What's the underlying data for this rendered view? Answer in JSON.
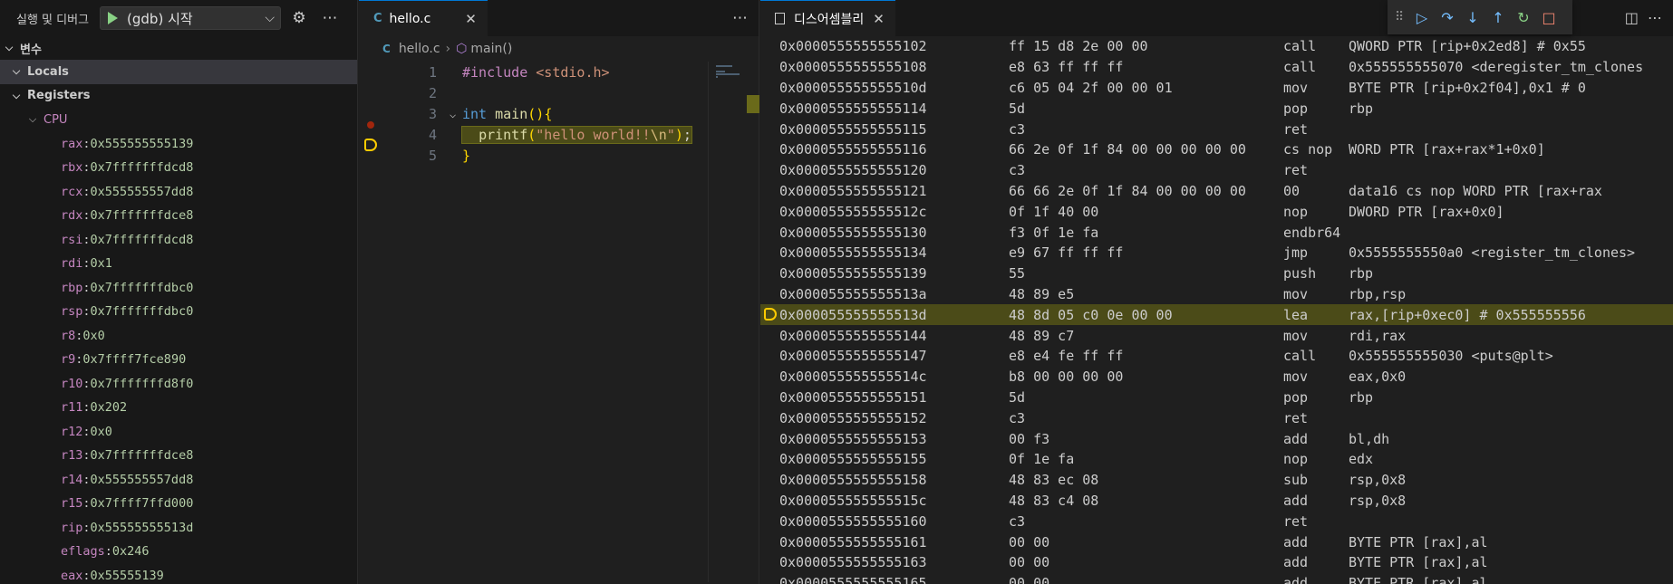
{
  "run": {
    "title": "실행 및 디버그",
    "config": "(gdb) 시작"
  },
  "variables": {
    "header": "변수",
    "locals": "Locals",
    "registers": "Registers",
    "cpu": "CPU",
    "regs": [
      {
        "name": "rax",
        "value": "0x555555555139"
      },
      {
        "name": "rbx",
        "value": "0x7fffffffdcd8"
      },
      {
        "name": "rcx",
        "value": "0x555555557dd8"
      },
      {
        "name": "rdx",
        "value": "0x7fffffffdce8"
      },
      {
        "name": "rsi",
        "value": "0x7fffffffdcd8"
      },
      {
        "name": "rdi",
        "value": "0x1"
      },
      {
        "name": "rbp",
        "value": "0x7fffffffdbc0"
      },
      {
        "name": "rsp",
        "value": "0x7fffffffdbc0"
      },
      {
        "name": "r8",
        "value": "0x0"
      },
      {
        "name": "r9",
        "value": "0x7ffff7fce890"
      },
      {
        "name": "r10",
        "value": "0x7fffffffd8f0"
      },
      {
        "name": "r11",
        "value": "0x202"
      },
      {
        "name": "r12",
        "value": "0x0"
      },
      {
        "name": "r13",
        "value": "0x7fffffffdce8"
      },
      {
        "name": "r14",
        "value": "0x555555557dd8"
      },
      {
        "name": "r15",
        "value": "0x7ffff7ffd000"
      },
      {
        "name": "rip",
        "value": "0x55555555513d"
      },
      {
        "name": "eflags",
        "value": "0x246"
      },
      {
        "name": "eax",
        "value": "0x55555139"
      }
    ]
  },
  "editor": {
    "tab_icon": "C",
    "tab_label": "hello.c",
    "breadcrumb_file": "hello.c",
    "breadcrumb_symbol": "main()",
    "lines": [
      {
        "num": "1",
        "text": "#include <stdio.h>"
      },
      {
        "num": "2",
        "text": ""
      },
      {
        "num": "3",
        "text": "int main(){"
      },
      {
        "num": "4",
        "text": "  printf(\"hello world!!\\n\");"
      },
      {
        "num": "5",
        "text": "}"
      }
    ],
    "current_line": 4,
    "breakpoint_line": 3
  },
  "disassembly": {
    "tab_label": "디스어셈블리",
    "current_index": 13,
    "rows": [
      {
        "addr": "0x0000555555555102",
        "bytes": "ff 15 d8 2e 00 00",
        "mnem": "call",
        "ops": "QWORD PTR [rip+0x2ed8]        # 0x55"
      },
      {
        "addr": "0x0000555555555108",
        "bytes": "e8 63 ff ff ff",
        "mnem": "call",
        "ops": "0x555555555070 <deregister_tm_clones"
      },
      {
        "addr": "0x000055555555510d",
        "bytes": "c6 05 04 2f 00 00 01",
        "mnem": "mov",
        "ops": "BYTE PTR [rip+0x2f04],0x1        # 0"
      },
      {
        "addr": "0x0000555555555114",
        "bytes": "5d",
        "mnem": "pop",
        "ops": "rbp"
      },
      {
        "addr": "0x0000555555555115",
        "bytes": "c3",
        "mnem": "ret",
        "ops": ""
      },
      {
        "addr": "0x0000555555555116",
        "bytes": "66 2e 0f 1f 84 00 00 00 00 00",
        "mnem": "cs nop",
        "ops": "WORD PTR [rax+rax*1+0x0]"
      },
      {
        "addr": "0x0000555555555120",
        "bytes": "c3",
        "mnem": "ret",
        "ops": ""
      },
      {
        "addr": "0x0000555555555121",
        "bytes": "66 66 2e 0f 1f 84 00 00 00 00",
        "mnem": "00",
        "ops": "       data16 cs nop WORD PTR [rax+rax"
      },
      {
        "addr": "0x000055555555512c",
        "bytes": "0f 1f 40 00",
        "mnem": "nop",
        "ops": "DWORD PTR [rax+0x0]"
      },
      {
        "addr": "0x0000555555555130",
        "bytes": "f3 0f 1e fa",
        "mnem": "endbr64",
        "ops": ""
      },
      {
        "addr": "0x0000555555555134",
        "bytes": "e9 67 ff ff ff",
        "mnem": "jmp",
        "ops": "0x5555555550a0 <register_tm_clones>"
      },
      {
        "addr": "0x0000555555555139",
        "bytes": "55",
        "mnem": "push",
        "ops": "rbp"
      },
      {
        "addr": "0x000055555555513a",
        "bytes": "48 89 e5",
        "mnem": "mov",
        "ops": "rbp,rsp"
      },
      {
        "addr": "0x000055555555513d",
        "bytes": "48 8d 05 c0 0e 00 00",
        "mnem": "lea",
        "ops": "rax,[rip+0xec0]        # 0x555555556"
      },
      {
        "addr": "0x0000555555555144",
        "bytes": "48 89 c7",
        "mnem": "mov",
        "ops": "rdi,rax"
      },
      {
        "addr": "0x0000555555555147",
        "bytes": "e8 e4 fe ff ff",
        "mnem": "call",
        "ops": "0x555555555030 <puts@plt>"
      },
      {
        "addr": "0x000055555555514c",
        "bytes": "b8 00 00 00 00",
        "mnem": "mov",
        "ops": "eax,0x0"
      },
      {
        "addr": "0x0000555555555151",
        "bytes": "5d",
        "mnem": "pop",
        "ops": "rbp"
      },
      {
        "addr": "0x0000555555555152",
        "bytes": "c3",
        "mnem": "ret",
        "ops": ""
      },
      {
        "addr": "0x0000555555555153",
        "bytes": "00 f3",
        "mnem": "add",
        "ops": "bl,dh"
      },
      {
        "addr": "0x0000555555555155",
        "bytes": "0f 1e fa",
        "mnem": "nop",
        "ops": "edx"
      },
      {
        "addr": "0x0000555555555158",
        "bytes": "48 83 ec 08",
        "mnem": "sub",
        "ops": "rsp,0x8"
      },
      {
        "addr": "0x000055555555515c",
        "bytes": "48 83 c4 08",
        "mnem": "add",
        "ops": "rsp,0x8"
      },
      {
        "addr": "0x0000555555555160",
        "bytes": "c3",
        "mnem": "ret",
        "ops": ""
      },
      {
        "addr": "0x0000555555555161",
        "bytes": "00 00",
        "mnem": "add",
        "ops": "BYTE PTR [rax],al"
      },
      {
        "addr": "0x0000555555555163",
        "bytes": "00 00",
        "mnem": "add",
        "ops": "BYTE PTR [rax],al"
      },
      {
        "addr": "0x0000555555555165",
        "bytes": "00 00",
        "mnem": "add",
        "ops": "BYTE PTR [rax],al"
      }
    ]
  },
  "icons": {
    "run_play": "play-icon",
    "settings": "gear-icon",
    "more": "ellipsis-icon",
    "continue": "continue-icon",
    "step_over": "step-over-icon",
    "step_into": "step-into-icon",
    "step_out": "step-out-icon",
    "restart": "restart-icon",
    "stop": "stop-icon"
  },
  "colors": {
    "current_line_bg": "#4b4b18",
    "exec_arrow": "#ffcc00",
    "register_name": "#c586c0",
    "register_value": "#b5cea8",
    "accent": "#0078d4"
  }
}
